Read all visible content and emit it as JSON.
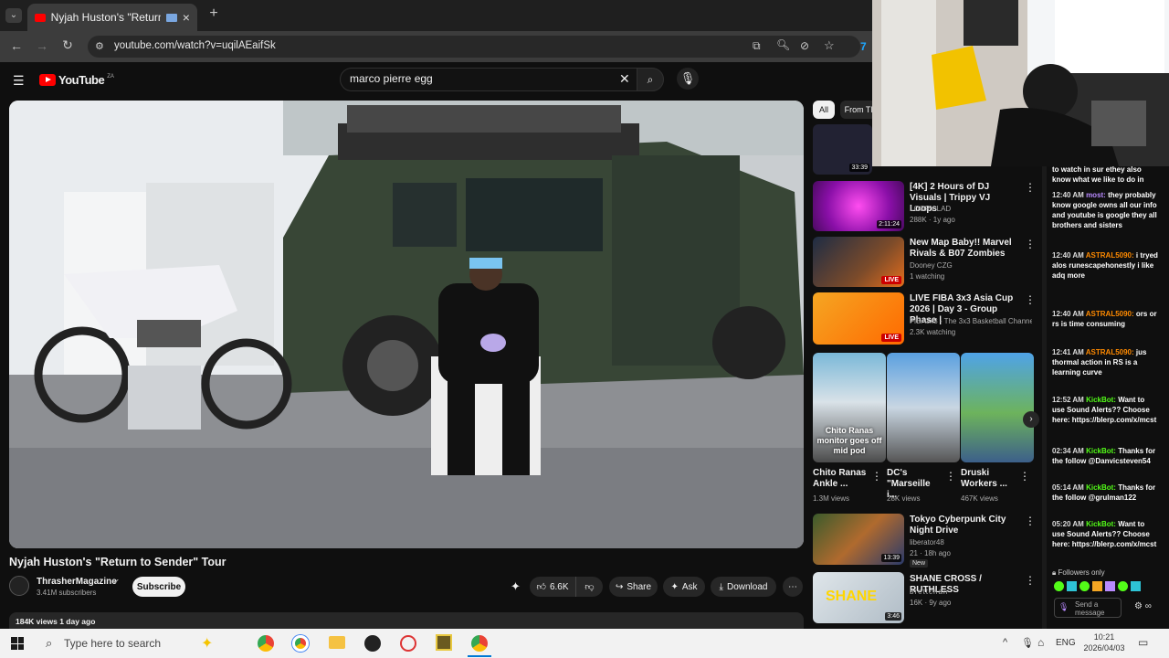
{
  "browser": {
    "tab_title": "Nyjah Huston's \"Return to S",
    "url": "youtube.com/watch?v=uqilAEaifSk",
    "new_tab": "+",
    "close": "×"
  },
  "youtube": {
    "logo": "YouTube",
    "logo_sup": "ZA",
    "search_value": "marco pierre egg"
  },
  "video": {
    "title": "Nyjah Huston's \"Return to Sender\" Tour",
    "channel": "ThrasherMagazine",
    "subscribers": "3.41M subscribers",
    "subscribe_label": "Subscribe",
    "likes": "6.6K",
    "share_label": "Share",
    "ask_label": "Ask",
    "download_label": "Download",
    "views_date": "184K views  1 day ago"
  },
  "filters": [
    "All",
    "From Tl"
  ],
  "sidebar": {
    "items": [
      {
        "title": "[4K] 2 Hours of DJ Visuals | Trippy VJ Loops",
        "channel": "LOOPY LAD",
        "meta": "288K · 1y ago",
        "badge": "2:11:24"
      },
      {
        "title": "New Map Baby!! Marvel Rivals & B07 Zombies",
        "channel": "Dooney CZG",
        "meta": "1 watching",
        "badge": "LIVE"
      },
      {
        "title": "LIVE FIBA 3x3 Asia Cup 2026 | Day 3 - Group Phase |",
        "channel": "FIBA3x3 - The 3x3 Basketball Channel",
        "meta": "2.3K watching",
        "badge": "LIVE"
      },
      {
        "title": "Tokyo Cyberpunk City Night Drive",
        "channel": "liberator48",
        "meta": "21 · 18h ago",
        "badge": "13:39",
        "tag": "New"
      },
      {
        "title": "SHANE CROSS / RUTHLESS",
        "channel": "brettchan",
        "meta": "16K · 9y ago",
        "badge": "3:46"
      }
    ],
    "shorts": [
      {
        "title": "Chito Ranas Ankle ...",
        "views": "1.3M views",
        "overlay": "Chito Ranas monitor goes off mid pod"
      },
      {
        "title": "DC's \"Marseille i...",
        "views": "28K views"
      },
      {
        "title": "Druski Workers ...",
        "views": "467K views"
      }
    ],
    "top_dur": "33:39"
  },
  "chat": {
    "messages": [
      {
        "time": "",
        "user": "",
        "text": "to watch in sur ethey also know what we like to do in"
      },
      {
        "time": "12:40 AM",
        "user": "most:",
        "text": "they probably know google owns all our info and youtube is google they all brothers and sisters"
      },
      {
        "time": "12:40 AM",
        "user": "ASTRAL5090:",
        "text": "i tryed alos runescapehonestly i like adq more"
      },
      {
        "time": "12:40 AM",
        "user": "ASTRAL5090:",
        "text": "ors or rs is time consuming"
      },
      {
        "time": "12:41 AM",
        "user": "ASTRAL5090:",
        "text": "jus thormal action in RS is a learning curve"
      },
      {
        "time": "12:52 AM",
        "user": "KickBot:",
        "text": "Want to use Sound Alerts?? Choose here: https://blerp.com/x/mcst"
      },
      {
        "time": "02:34 AM",
        "user": "KickBot:",
        "text": "Thanks for the follow @Danvicsteven54"
      },
      {
        "time": "05:14 AM",
        "user": "KickBot:",
        "text": "Thanks for the follow @grulman122"
      },
      {
        "time": "05:20 AM",
        "user": "KickBot:",
        "text": "Want to use Sound Alerts?? Choose here: https://blerp.com/x/mcst"
      }
    ],
    "followers_only": "Followers only",
    "send_placeholder": "Send a message"
  },
  "taskbar": {
    "search_placeholder": "Type here to search",
    "lang": "ENG",
    "time": "10:21",
    "date": "2026/04/03"
  },
  "colors": {
    "yt_red": "#ff0000",
    "kick_green": "#53fc18",
    "chat_orange": "#ff8a00"
  }
}
